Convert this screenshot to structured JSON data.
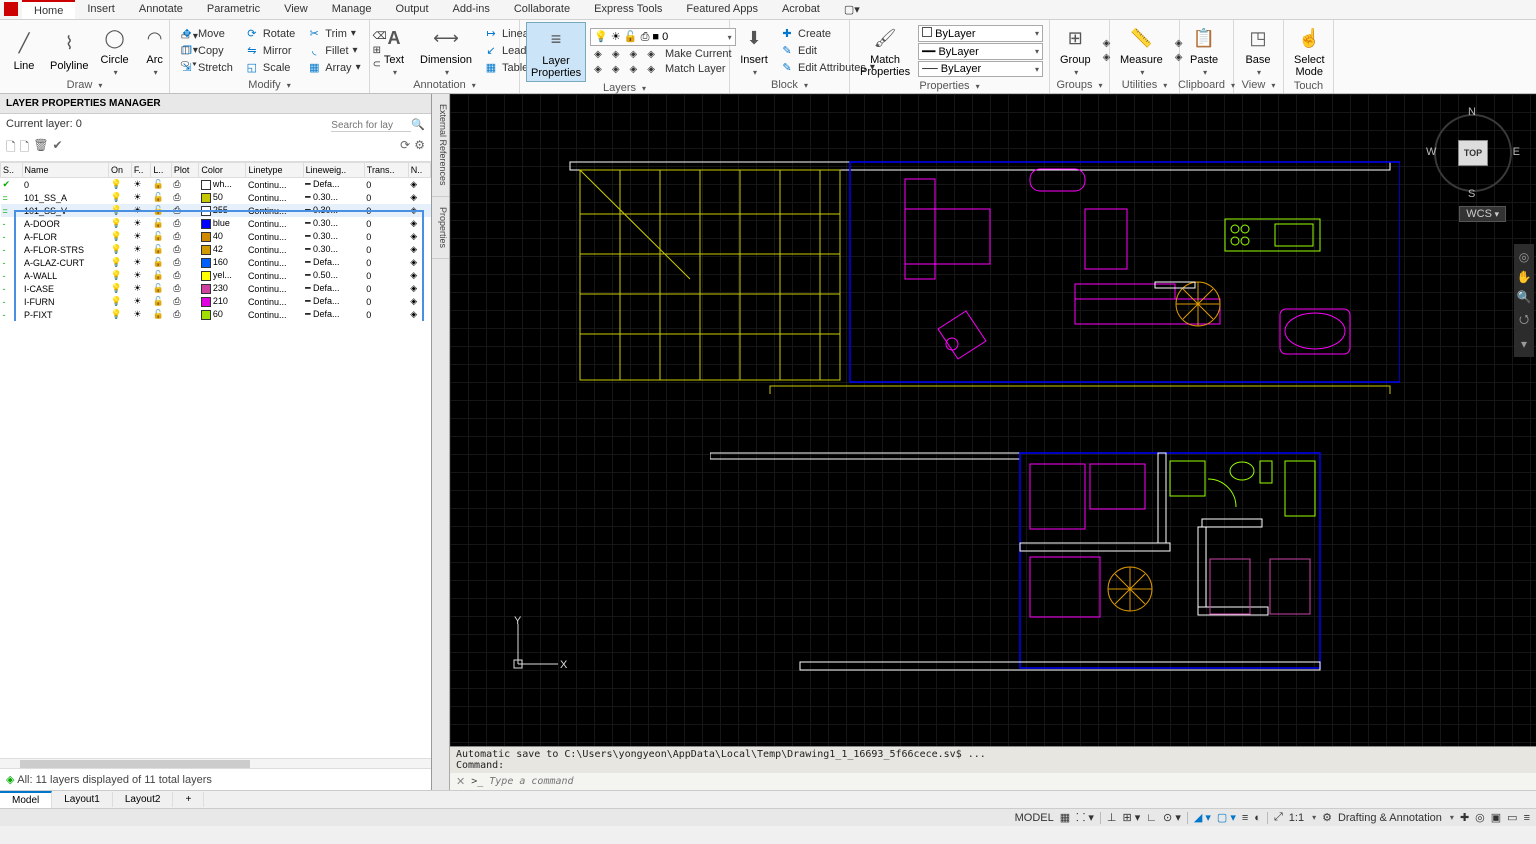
{
  "ribbonTabs": [
    "Home",
    "Insert",
    "Annotate",
    "Parametric",
    "View",
    "Manage",
    "Output",
    "Add-ins",
    "Collaborate",
    "Express Tools",
    "Featured Apps",
    "Acrobat"
  ],
  "activeTab": "Home",
  "panels": {
    "draw": {
      "label": "Draw",
      "items": [
        "Line",
        "Polyline",
        "Circle",
        "Arc"
      ]
    },
    "modify": {
      "label": "Modify",
      "move": "Move",
      "copy": "Copy",
      "stretch": "Stretch",
      "rotate": "Rotate",
      "mirror": "Mirror",
      "scale": "Scale",
      "trim": "Trim",
      "fillet": "Fillet",
      "array": "Array"
    },
    "annotation": {
      "label": "Annotation",
      "text": "Text",
      "dimension": "Dimension",
      "linear": "Linear",
      "leader": "Leader",
      "table": "Table"
    },
    "layers": {
      "label": "Layers",
      "props": "Layer\nProperties",
      "current": "0",
      "make": "Make Current",
      "match": "Match Layer"
    },
    "block": {
      "label": "Block",
      "insert": "Insert",
      "create": "Create",
      "edit": "Edit",
      "attrs": "Edit Attributes"
    },
    "properties": {
      "label": "Properties",
      "match": "Match\nProperties",
      "bylayer": "ByLayer"
    },
    "groups": {
      "label": "Groups",
      "group": "Group"
    },
    "utilities": {
      "label": "Utilities",
      "measure": "Measure"
    },
    "clipboard": {
      "label": "Clipboard",
      "paste": "Paste"
    },
    "view": {
      "label": "View",
      "base": "Base"
    },
    "touch": {
      "label": "Touch",
      "mode": "Select\nMode"
    }
  },
  "layerManager": {
    "title": "LAYER PROPERTIES MANAGER",
    "current": "Current layer: 0",
    "searchPlaceholder": "Search for layer",
    "columns": [
      "S..",
      "Name",
      "On",
      "F..",
      "L..",
      "Plot",
      "Color",
      "Linetype",
      "Lineweig..",
      "Trans..",
      "N.."
    ],
    "rows": [
      {
        "status": "✔",
        "name": "0",
        "color": "wh...",
        "colorHex": "#ffffff",
        "lt": "Continu...",
        "lw": "Defa...",
        "tr": "0"
      },
      {
        "status": "=",
        "name": "101_SS_A",
        "color": "50",
        "colorHex": "#c8c800",
        "lt": "Continu...",
        "lw": "0.30...",
        "tr": "0"
      },
      {
        "status": "=",
        "name": "101_SS_V",
        "color": "255",
        "colorHex": "#ffffff",
        "lt": "Continu...",
        "lw": "0.30...",
        "tr": "0",
        "sel": true
      },
      {
        "status": "-",
        "name": "A-DOOR",
        "color": "blue",
        "colorHex": "#0000ff",
        "lt": "Continu...",
        "lw": "0.30...",
        "tr": "0"
      },
      {
        "status": "-",
        "name": "A-FLOR",
        "color": "40",
        "colorHex": "#d08a00",
        "lt": "Continu...",
        "lw": "0.30...",
        "tr": "0"
      },
      {
        "status": "-",
        "name": "A-FLOR-STRS",
        "color": "42",
        "colorHex": "#d09a00",
        "lt": "Continu...",
        "lw": "0.30...",
        "tr": "0"
      },
      {
        "status": "-",
        "name": "A-GLAZ-CURT",
        "color": "160",
        "colorHex": "#0060ff",
        "lt": "Continu...",
        "lw": "Defa...",
        "tr": "0"
      },
      {
        "status": "-",
        "name": "A-WALL",
        "color": "yel...",
        "colorHex": "#ffff00",
        "lt": "Continu...",
        "lw": "0.50...",
        "tr": "0"
      },
      {
        "status": "-",
        "name": "I-CASE",
        "color": "230",
        "colorHex": "#d040a0",
        "lt": "Continu...",
        "lw": "Defa...",
        "tr": "0"
      },
      {
        "status": "-",
        "name": "I-FURN",
        "color": "210",
        "colorHex": "#e000e0",
        "lt": "Continu...",
        "lw": "Defa...",
        "tr": "0"
      },
      {
        "status": "-",
        "name": "P-FIXT",
        "color": "60",
        "colorHex": "#a0e000",
        "lt": "Continu...",
        "lw": "Defa...",
        "tr": "0"
      }
    ],
    "footer": "All: 11 layers displayed of 11 total layers"
  },
  "sideTabs": [
    "External References",
    "Properties"
  ],
  "viewcube": {
    "top": "TOP",
    "n": "N",
    "s": "S",
    "e": "E",
    "w": "W",
    "wcs": "WCS"
  },
  "cmd": {
    "log": "Automatic save to C:\\Users\\yongyeon\\AppData\\Local\\Temp\\Drawing1_1_16693_5f66cece.sv$ ...\nCommand:",
    "prefix": ">_",
    "placeholder": "Type a command"
  },
  "bottomTabs": [
    "Model",
    "Layout1",
    "Layout2"
  ],
  "status": {
    "model": "MODEL",
    "scale": "1:1",
    "workspace": "Drafting & Annotation"
  },
  "ucs": {
    "x": "X",
    "y": "Y"
  }
}
